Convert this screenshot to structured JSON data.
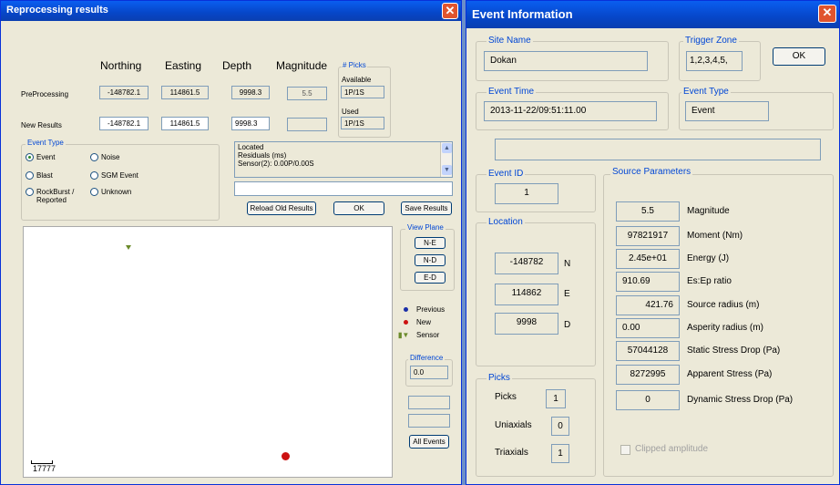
{
  "left_window": {
    "title": "Reprocessing results",
    "close_glyph": "✕",
    "headers": {
      "northing": "Northing",
      "easting": "Easting",
      "depth": "Depth",
      "magnitude": "Magnitude",
      "picks": "# Picks"
    },
    "preprocessing": {
      "label": "PreProcessing",
      "northing": "-148782.1",
      "easting": "114861.5",
      "depth": "9998.3",
      "magnitude": "5.5",
      "available_label": "Available",
      "available": "1P/1S"
    },
    "new_results": {
      "label": "New Results",
      "northing": "-148782.1",
      "easting": "114861.5",
      "depth": "9998.3",
      "magnitude": "",
      "used_label": "Used",
      "used": "1P/1S"
    },
    "event_type": {
      "label": "Event Type",
      "options": [
        "Event",
        "Noise",
        "Blast",
        "SGM Event",
        "RockBurst / Reported",
        "Unknown"
      ],
      "selected": "Event"
    },
    "log": {
      "line1": "Located",
      "line2": "Residuals (ms)",
      "line3": "Sensor(2):  0.00P/0.00S"
    },
    "buttons": {
      "reload": "Reload Old Results",
      "ok": "OK",
      "save": "Save Results",
      "all_events": "All Events"
    },
    "view_plane": {
      "label": "View Plane",
      "ne": "N-E",
      "nd": "N-D",
      "ed": "E-D"
    },
    "legend": {
      "previous": "Previous",
      "new": "New",
      "sensor": "Sensor",
      "previous_color": "#1a2ea8",
      "new_color": "#cc1111",
      "sensor_color": "#6a8a2a"
    },
    "difference": {
      "label": "Difference",
      "value": "0.0"
    },
    "scale_label": "17777"
  },
  "right_window": {
    "title": "Event Information",
    "close_glyph": "✕",
    "site_name": {
      "label": "Site Name",
      "value": "Dokan"
    },
    "trigger_zone": {
      "label": "Trigger Zone",
      "value": "1,2,3,4,5,"
    },
    "ok_label": "OK",
    "event_time": {
      "label": "Event Time",
      "value": "2013-11-22/09:51:11.00"
    },
    "event_type": {
      "label": "Event Type",
      "value": "Event"
    },
    "event_id": {
      "label": "Event ID",
      "value": "1"
    },
    "location": {
      "label": "Location",
      "n": "-148782",
      "n_label": "N",
      "e": "114862",
      "e_label": "E",
      "d": "9998",
      "d_label": "D"
    },
    "picks": {
      "label": "Picks",
      "picks_label": "Picks",
      "picks": "1",
      "uniaxials_label": "Uniaxials",
      "uniaxials": "0",
      "triaxials_label": "Triaxials",
      "triaxials": "1"
    },
    "source_parameters": {
      "label": "Source Parameters",
      "rows": [
        {
          "value": "5.5",
          "label": "Magnitude"
        },
        {
          "value": "97821917",
          "label": "Moment (Nm)"
        },
        {
          "value": "2.45e+01",
          "label": "Energy (J)"
        },
        {
          "value": "910.69",
          "label": "Es:Ep ratio"
        },
        {
          "value": "421.76",
          "label": "Source radius (m)"
        },
        {
          "value": "0.00",
          "label": "Asperity radius (m)"
        },
        {
          "value": "57044128",
          "label": "Static Stress Drop (Pa)"
        },
        {
          "value": "8272995",
          "label": "Apparent Stress (Pa)"
        },
        {
          "value": "0",
          "label": "Dynamic Stress Drop (Pa)"
        }
      ]
    },
    "clipped_label": "Clipped amplitude"
  }
}
